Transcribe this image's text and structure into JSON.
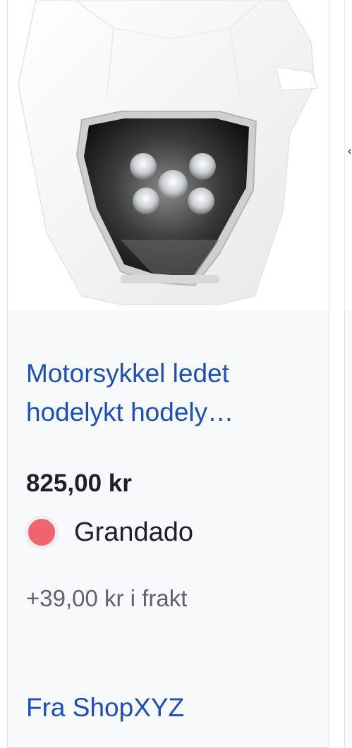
{
  "product": {
    "title": "Motorsykkel ledet hodelykt hodelykt Supermoto Fairing Lamp",
    "title_visible": "Motorsykkel ledet hodelykt hodely…",
    "price": "825,00 kr",
    "seller": "Grandado",
    "shipping": "+39,00 kr i frakt",
    "from": "Fra ShopXYZ",
    "image_alt": "White motorcycle headlight fairing with LED lamp"
  },
  "colors": {
    "link": "#1a4fbf",
    "seller_dot": "#f06470",
    "info_bg": "#f8f9fa"
  },
  "peek": {
    "mark": "‹"
  }
}
